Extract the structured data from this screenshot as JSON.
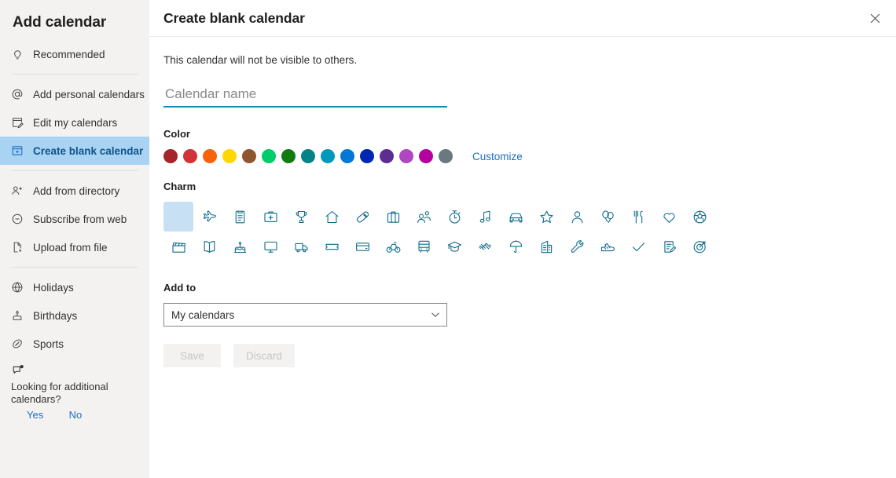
{
  "sidebar": {
    "title": "Add calendar",
    "groups": [
      {
        "items": [
          {
            "label": "Recommended",
            "icon": "lightbulb-icon",
            "selected": false
          }
        ]
      },
      {
        "items": [
          {
            "label": "Add personal calendars",
            "icon": "at-sign-icon",
            "selected": false
          },
          {
            "label": "Edit my calendars",
            "icon": "edit-calendar-icon",
            "selected": false
          },
          {
            "label": "Create blank calendar",
            "icon": "calendar-add-icon",
            "selected": true
          }
        ]
      },
      {
        "items": [
          {
            "label": "Add from directory",
            "icon": "person-add-icon",
            "selected": false
          },
          {
            "label": "Subscribe from web",
            "icon": "circle-minus-icon",
            "selected": false
          },
          {
            "label": "Upload from file",
            "icon": "file-add-icon",
            "selected": false
          }
        ]
      },
      {
        "items": [
          {
            "label": "Holidays",
            "icon": "globe-icon",
            "selected": false
          },
          {
            "label": "Birthdays",
            "icon": "cake-icon",
            "selected": false
          },
          {
            "label": "Sports",
            "icon": "sports-ball-icon",
            "selected": false
          }
        ]
      }
    ],
    "feedback": {
      "icon": "feedback-bubble-icon",
      "text": "Looking for additional calendars?",
      "yes_label": "Yes",
      "no_label": "No"
    },
    "selected_highlight_color": "#a9d3f2",
    "selected_text_color": "#10538c",
    "background_color": "#f3f2f1"
  },
  "header": {
    "title": "Create blank calendar",
    "close_icon": "close-icon"
  },
  "main": {
    "subtitle": "This calendar will not be visible to others.",
    "name_field": {
      "placeholder": "Calendar name",
      "value": "",
      "underline_color": "#0f8dba"
    },
    "color": {
      "label": "Color",
      "customize_label": "Customize",
      "swatches": [
        {
          "name": "dark-red",
          "hex": "#a4262c"
        },
        {
          "name": "red",
          "hex": "#d13438"
        },
        {
          "name": "orange",
          "hex": "#f7630c"
        },
        {
          "name": "yellow",
          "hex": "#ffd700"
        },
        {
          "name": "brown",
          "hex": "#8e562e"
        },
        {
          "name": "light-green",
          "hex": "#00cc6a"
        },
        {
          "name": "dark-green",
          "hex": "#107c10"
        },
        {
          "name": "teal",
          "hex": "#038387"
        },
        {
          "name": "cyan",
          "hex": "#0099bc"
        },
        {
          "name": "blue",
          "hex": "#0078d4"
        },
        {
          "name": "dark-blue",
          "hex": "#0027b4"
        },
        {
          "name": "dark-purple",
          "hex": "#5c2e91"
        },
        {
          "name": "purple",
          "hex": "#b146c2"
        },
        {
          "name": "magenta",
          "hex": "#b4009e"
        },
        {
          "name": "gray",
          "hex": "#69797e"
        }
      ]
    },
    "charm": {
      "label": "Charm",
      "icon_color": "#0f6c8c",
      "selected_background": "#c7e0f4",
      "rows": [
        [
          {
            "name": "none-charm",
            "selected": true
          },
          {
            "name": "airplane-icon",
            "selected": false
          },
          {
            "name": "clipboard-icon",
            "selected": false
          },
          {
            "name": "first-aid-kit-icon",
            "selected": false
          },
          {
            "name": "trophy-icon",
            "selected": false
          },
          {
            "name": "home-icon",
            "selected": false
          },
          {
            "name": "pill-icon",
            "selected": false
          },
          {
            "name": "briefcase-icon",
            "selected": false
          },
          {
            "name": "people-icon",
            "selected": false
          },
          {
            "name": "stopwatch-icon",
            "selected": false
          },
          {
            "name": "music-note-icon",
            "selected": false
          },
          {
            "name": "car-icon",
            "selected": false
          },
          {
            "name": "star-icon",
            "selected": false
          },
          {
            "name": "person-icon",
            "selected": false
          },
          {
            "name": "balloons-icon",
            "selected": false
          },
          {
            "name": "cutlery-icon",
            "selected": false
          },
          {
            "name": "heart-icon",
            "selected": false
          },
          {
            "name": "soccer-ball-icon",
            "selected": false
          }
        ],
        [
          {
            "name": "clapperboard-icon",
            "selected": false
          },
          {
            "name": "book-icon",
            "selected": false
          },
          {
            "name": "birthday-cake-icon",
            "selected": false
          },
          {
            "name": "monitor-icon",
            "selected": false
          },
          {
            "name": "truck-icon",
            "selected": false
          },
          {
            "name": "ticket-icon",
            "selected": false
          },
          {
            "name": "credit-card-icon",
            "selected": false
          },
          {
            "name": "bicycle-icon",
            "selected": false
          },
          {
            "name": "bus-icon",
            "selected": false
          },
          {
            "name": "graduation-cap-icon",
            "selected": false
          },
          {
            "name": "dumbbell-icon",
            "selected": false
          },
          {
            "name": "beach-umbrella-icon",
            "selected": false
          },
          {
            "name": "building-icon",
            "selected": false
          },
          {
            "name": "wrench-icon",
            "selected": false
          },
          {
            "name": "running-shoe-icon",
            "selected": false
          },
          {
            "name": "checkmark-icon",
            "selected": false
          },
          {
            "name": "notepad-edit-icon",
            "selected": false
          },
          {
            "name": "target-icon",
            "selected": false
          }
        ]
      ]
    },
    "add_to": {
      "label": "Add to",
      "value": "My calendars",
      "options": [
        "My calendars"
      ],
      "chevron_icon": "chevron-down-icon"
    },
    "buttons": {
      "save_label": "Save",
      "discard_label": "Discard",
      "disabled": true
    }
  }
}
